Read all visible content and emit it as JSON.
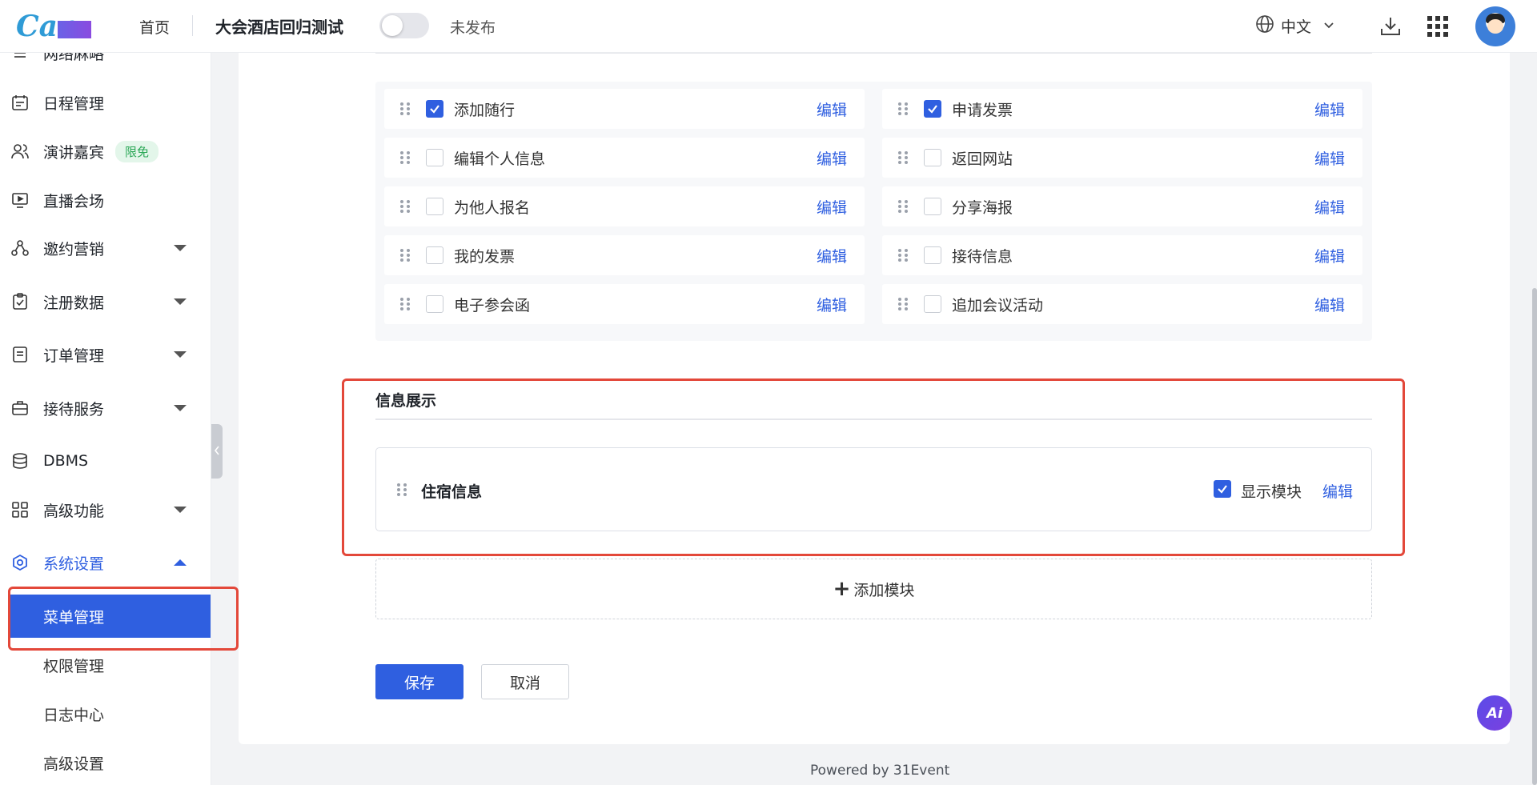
{
  "header": {
    "brand": "Can",
    "home_label": "首页",
    "event_title": "大会酒店回归测试",
    "publish_status": "未发布",
    "language": "中文"
  },
  "sidebar": {
    "items": [
      {
        "label": "网络麻略",
        "icon": "list-icon"
      },
      {
        "label": "日程管理",
        "icon": "calendar-icon"
      },
      {
        "label": "演讲嘉宾",
        "icon": "users-icon",
        "badge": "限免"
      },
      {
        "label": "直播会场",
        "icon": "live-icon"
      },
      {
        "label": "邀约营销",
        "icon": "share-icon"
      },
      {
        "label": "注册数据",
        "icon": "clipboard-icon"
      },
      {
        "label": "订单管理",
        "icon": "order-icon"
      },
      {
        "label": "接待服务",
        "icon": "bag-icon"
      },
      {
        "label": "DBMS",
        "icon": "database-icon"
      },
      {
        "label": "高级功能",
        "icon": "grid-icon"
      },
      {
        "label": "系统设置",
        "icon": "settings-icon"
      }
    ],
    "sub_items": [
      "菜单管理",
      "权限管理",
      "日志中心",
      "高级设置"
    ]
  },
  "modules": {
    "left": [
      {
        "label": "添加随行",
        "checked": true,
        "edit": "编辑"
      },
      {
        "label": "编辑个人信息",
        "checked": false,
        "edit": "编辑"
      },
      {
        "label": "为他人报名",
        "checked": false,
        "edit": "编辑"
      },
      {
        "label": "我的发票",
        "checked": false,
        "edit": "编辑"
      },
      {
        "label": "电子参会函",
        "checked": false,
        "edit": "编辑"
      }
    ],
    "right": [
      {
        "label": "申请发票",
        "checked": true,
        "edit": "编辑"
      },
      {
        "label": "返回网站",
        "checked": false,
        "edit": "编辑"
      },
      {
        "label": "分享海报",
        "checked": false,
        "edit": "编辑"
      },
      {
        "label": "接待信息",
        "checked": false,
        "edit": "编辑"
      },
      {
        "label": "追加会议活动",
        "checked": false,
        "edit": "编辑"
      }
    ]
  },
  "info_section": {
    "title": "信息展示",
    "card_label": "住宿信息",
    "show_label": "显示模块",
    "show_checked": true,
    "edit": "编辑"
  },
  "add_module": "添加模块",
  "buttons": {
    "save": "保存",
    "cancel": "取消"
  },
  "footer": "Powered by 31Event",
  "ai_label": "Ai",
  "colors": {
    "accent": "#2f5fe0",
    "highlight": "#e3483a",
    "badge_bg": "#e3f6ea",
    "badge_text": "#2aa756"
  }
}
